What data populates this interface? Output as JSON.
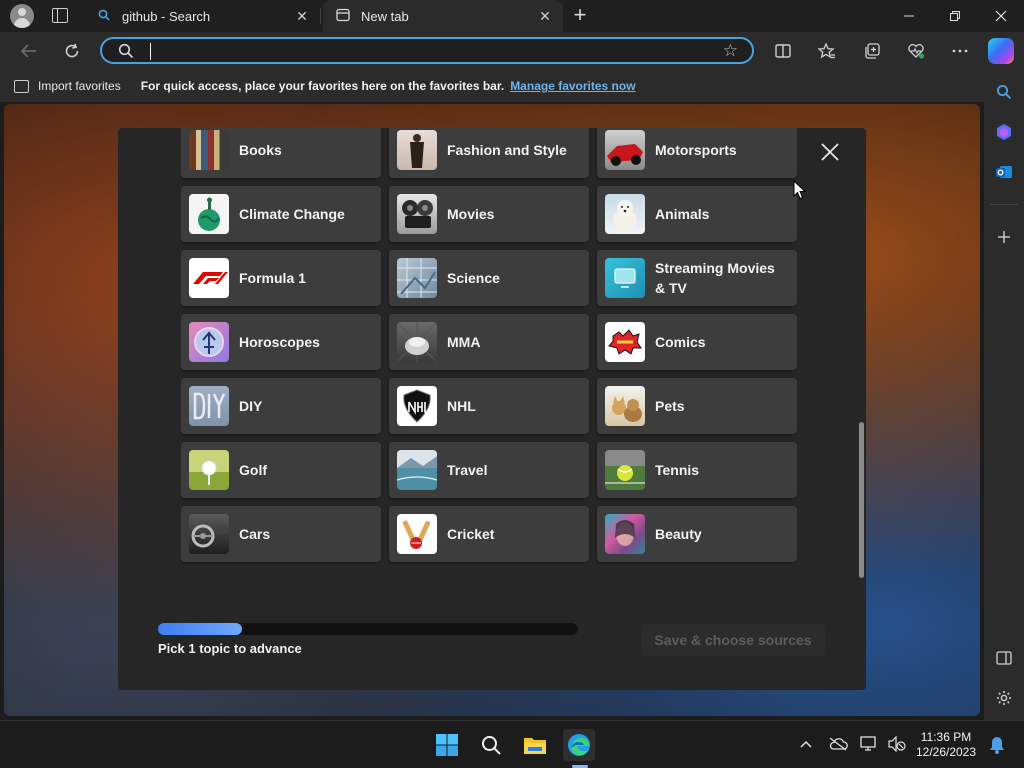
{
  "browser": {
    "tabs": [
      {
        "title": "github - Search",
        "icon": "search-icon"
      },
      {
        "title": "New tab",
        "icon": "newtab-page-icon"
      }
    ],
    "address_bar": {
      "value": "",
      "placeholder": ""
    },
    "favorites_bar": {
      "import_label": "Import favorites",
      "message": "For quick access, place your favorites here on the favorites bar.",
      "manage_link": "Manage favorites now"
    }
  },
  "modal": {
    "topics": [
      {
        "label": "Books",
        "icon": "books-thumbnail"
      },
      {
        "label": "Fashion and Style",
        "icon": "fashion-thumbnail"
      },
      {
        "label": "Motorsports",
        "icon": "motorsports-thumbnail"
      },
      {
        "label": "Climate Change",
        "icon": "climate-thumbnail"
      },
      {
        "label": "Movies",
        "icon": "movies-thumbnail"
      },
      {
        "label": "Animals",
        "icon": "animals-thumbnail"
      },
      {
        "label": "Formula 1",
        "icon": "formula1-thumbnail"
      },
      {
        "label": "Science",
        "icon": "science-thumbnail"
      },
      {
        "label": "Streaming Movies & TV",
        "icon": "streaming-thumbnail"
      },
      {
        "label": "Horoscopes",
        "icon": "horoscopes-thumbnail"
      },
      {
        "label": "MMA",
        "icon": "mma-thumbnail"
      },
      {
        "label": "Comics",
        "icon": "comics-thumbnail"
      },
      {
        "label": "DIY",
        "icon": "diy-thumbnail"
      },
      {
        "label": "NHL",
        "icon": "nhl-thumbnail"
      },
      {
        "label": "Pets",
        "icon": "pets-thumbnail"
      },
      {
        "label": "Golf",
        "icon": "golf-thumbnail"
      },
      {
        "label": "Travel",
        "icon": "travel-thumbnail"
      },
      {
        "label": "Tennis",
        "icon": "tennis-thumbnail"
      },
      {
        "label": "Cars",
        "icon": "cars-thumbnail"
      },
      {
        "label": "Cricket",
        "icon": "cricket-thumbnail"
      },
      {
        "label": "Beauty",
        "icon": "beauty-thumbnail"
      }
    ],
    "progress": {
      "value": 0.2
    },
    "progress_label": "Pick 1 topic to advance",
    "save_button": "Save & choose sources"
  },
  "taskbar": {
    "time": "11:36 PM",
    "date": "12/26/2023"
  },
  "colors": {
    "accent": "#4aa3df",
    "link": "#6ab4f0",
    "progress": "#3f7ef5",
    "tile": "#3d3d3d",
    "modal": "#262626"
  }
}
